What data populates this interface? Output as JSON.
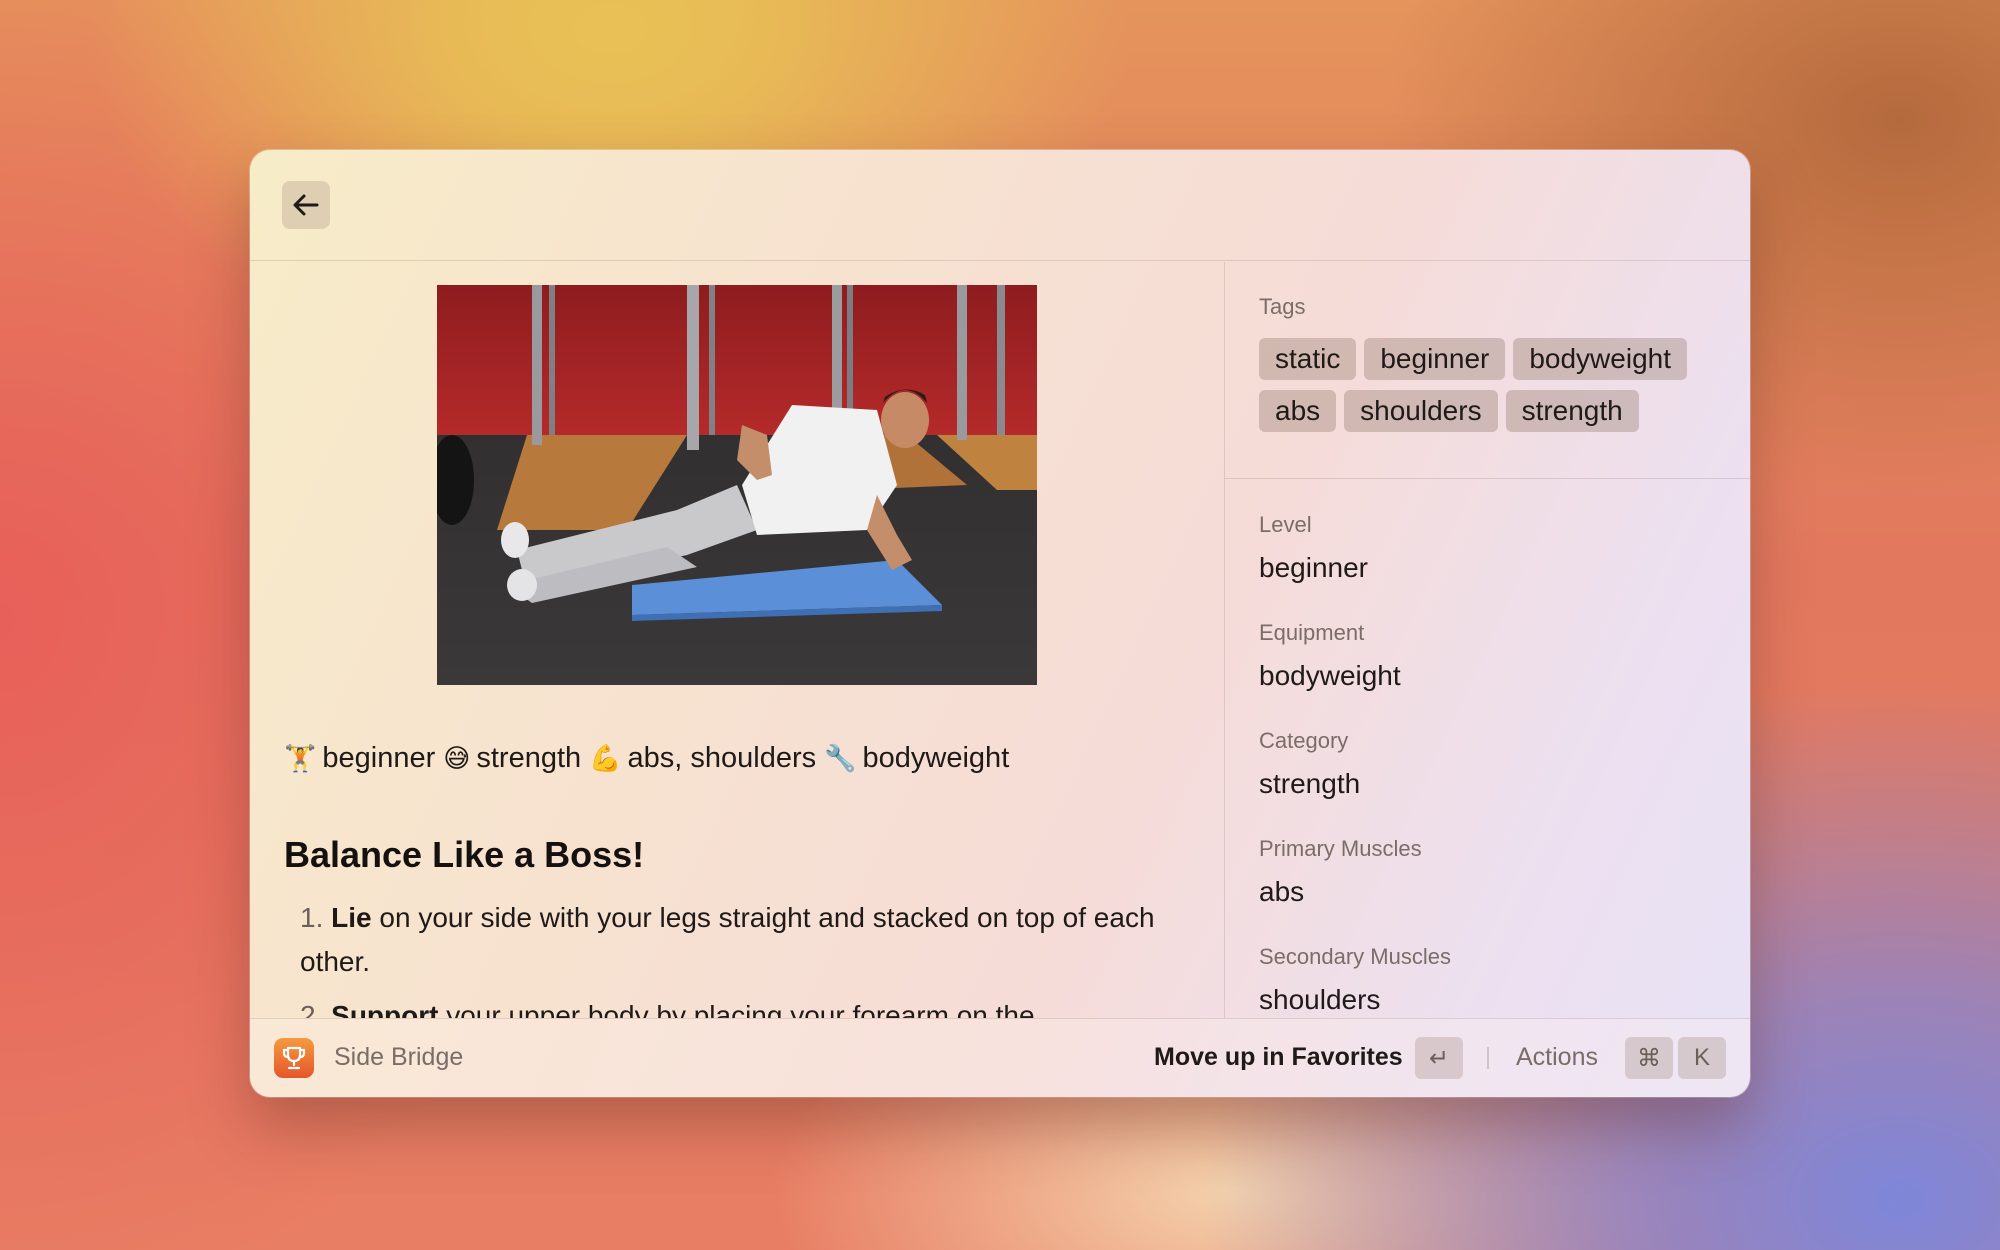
{
  "exercise": {
    "name": "Side Bridge",
    "summary": {
      "level_emoji": "🏋️",
      "level": "beginner",
      "category_emoji": "😅",
      "category": "strength",
      "muscles_emoji": "💪",
      "muscles": "abs, shoulders",
      "equipment_emoji": "🔧",
      "equipment": "bodyweight"
    },
    "heading": "Balance Like a Boss!",
    "steps": [
      {
        "num": "1.",
        "bold": "Lie",
        "text": " on your side with your legs straight and stacked on top of each other."
      },
      {
        "num": "2.",
        "bold": "Support",
        "text": " your upper body by placing your forearm on the"
      }
    ]
  },
  "sidebar": {
    "tags_title": "Tags",
    "tags": [
      "static",
      "beginner",
      "bodyweight",
      "abs",
      "shoulders",
      "strength"
    ],
    "fields": [
      {
        "label": "Level",
        "value": "beginner"
      },
      {
        "label": "Equipment",
        "value": "bodyweight"
      },
      {
        "label": "Category",
        "value": "strength"
      },
      {
        "label": "Primary Muscles",
        "value": "abs"
      },
      {
        "label": "Secondary Muscles",
        "value": "shoulders"
      }
    ]
  },
  "footer": {
    "app_title": "Side Bridge",
    "primary_action": "Move up in Favorites",
    "primary_key": "↵",
    "actions_label": "Actions",
    "actions_keys": [
      "⌘",
      "K"
    ]
  },
  "icons": {
    "back": "arrow-left-icon",
    "app": "trophy-icon"
  },
  "colors": {
    "app_icon_top": "#f59a3e",
    "app_icon_bottom": "#e5562b",
    "tag_bg": "#c9b1a5"
  }
}
